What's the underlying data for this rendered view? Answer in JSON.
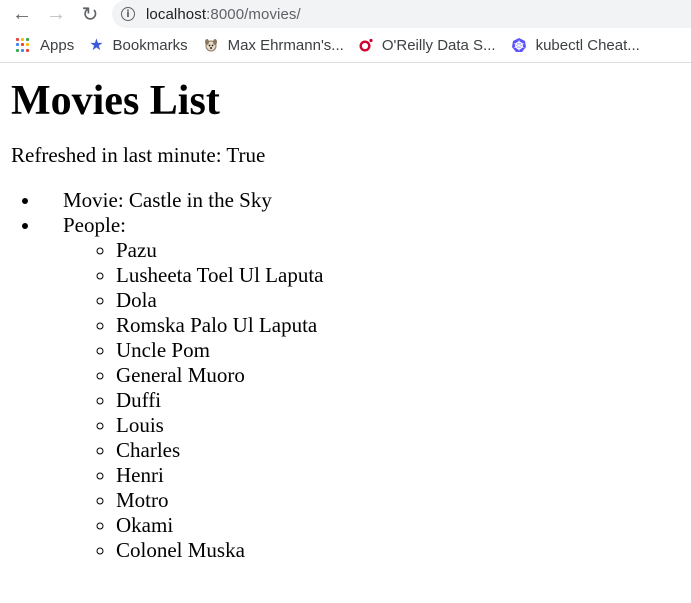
{
  "browser": {
    "url_host": "localhost",
    "url_path": ":8000/movies/",
    "bookmarks": [
      {
        "label": "Apps",
        "icon": "apps-grid-icon"
      },
      {
        "label": "Bookmarks",
        "icon": "star-icon",
        "color": "#3b5bdb"
      },
      {
        "label": "Max Ehrmann's...",
        "icon": "dog-icon"
      },
      {
        "label": "O'Reilly Data S...",
        "icon": "oreilly-icon",
        "color": "#d3002d"
      },
      {
        "label": "kubectl Cheat...",
        "icon": "kubernetes-icon",
        "color": "#5b53ff"
      }
    ]
  },
  "page": {
    "title": "Movies List",
    "refresh_text": "Refreshed in last minute: True",
    "movie_text": "Movie: Castle in the Sky",
    "people_label": "People:",
    "people": [
      "Pazu",
      "Lusheeta Toel Ul Laputa",
      "Dola",
      "Romska Palo Ul Laputa",
      "Uncle Pom",
      "General Muoro",
      "Duffi",
      "Louis",
      "Charles",
      "Henri",
      "Motro",
      "Okami",
      "Colonel Muska"
    ]
  }
}
